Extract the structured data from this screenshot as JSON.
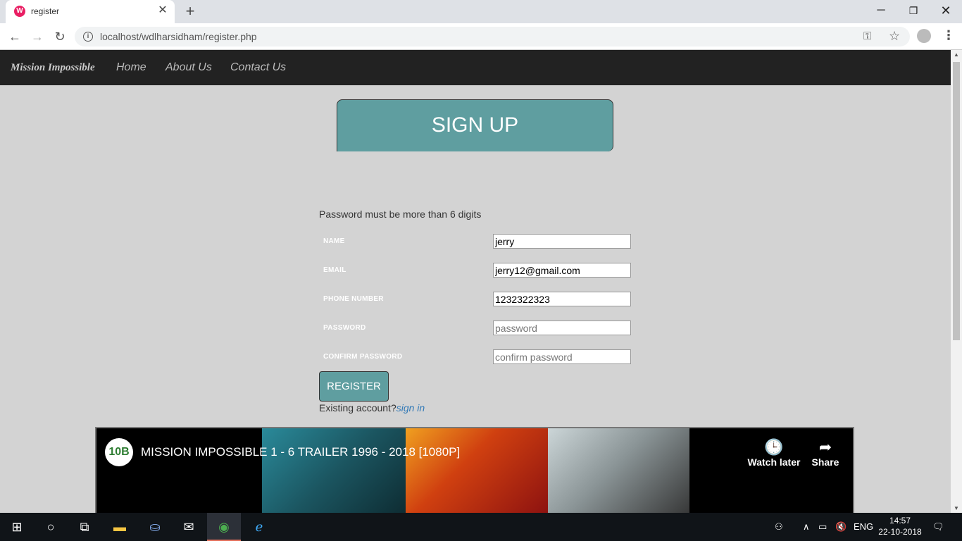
{
  "browser": {
    "tab_title": "register",
    "tab_favicon": "W",
    "url": "localhost/wdlharsidham/register.php"
  },
  "site": {
    "brand": "Mission Impossible",
    "nav": [
      "Home",
      "About Us",
      "Contact Us"
    ]
  },
  "signup": {
    "title": "SIGN UP",
    "password_note": "Password must be more than 6 digits",
    "fields": [
      {
        "label": "NAME",
        "value": "jerry",
        "placeholder": ""
      },
      {
        "label": "EMAIL",
        "value": "jerry12@gmail.com",
        "placeholder": ""
      },
      {
        "label": "PHONE NUMBER",
        "value": "1232322323",
        "placeholder": ""
      },
      {
        "label": "PASSWORD",
        "value": "",
        "placeholder": "password"
      },
      {
        "label": "CONFIRM PASSWORD",
        "value": "",
        "placeholder": "confirm password"
      }
    ],
    "register_label": "REGISTER",
    "existing_text": "Existing account?",
    "signin_link": "sign in"
  },
  "video": {
    "channel_logo": "10B",
    "title": "MISSION IMPOSSIBLE 1 - 6 TRAILER 1996 - 2018 [1080P]",
    "watch_later": "Watch later",
    "share": "Share"
  },
  "taskbar": {
    "language": "ENG",
    "time": "14:57",
    "date": "22-10-2018"
  },
  "colors": {
    "accent": "#5f9ea0",
    "navbar": "#222222",
    "page_bg": "#d3d3d3"
  }
}
